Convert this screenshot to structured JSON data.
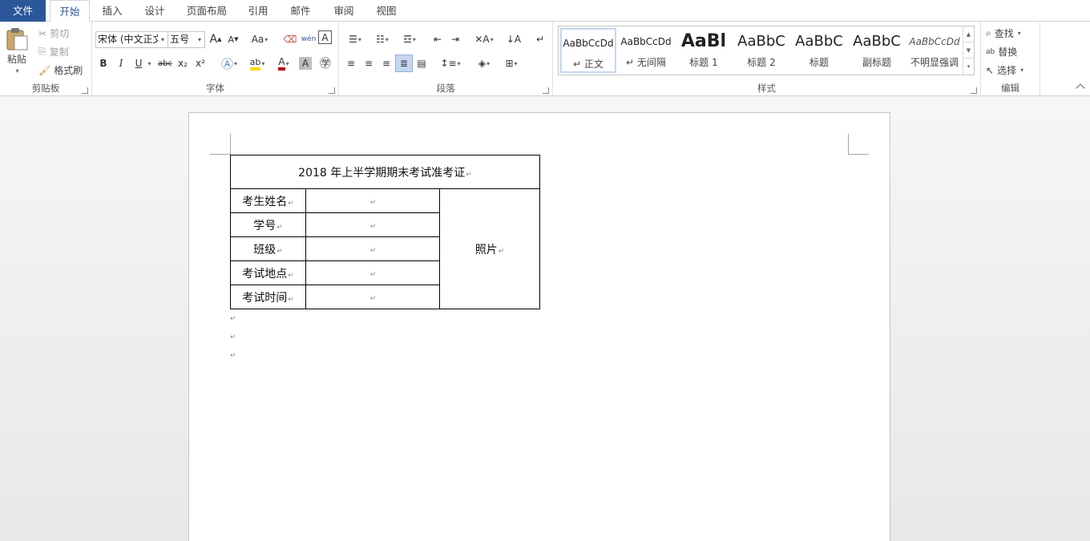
{
  "tabs": [
    "文件",
    "开始",
    "插入",
    "设计",
    "页面布局",
    "引用",
    "邮件",
    "审阅",
    "视图"
  ],
  "clipboard": {
    "label": "剪贴板",
    "paste": "粘贴",
    "cut": "剪切",
    "copy": "复制",
    "format_painter": "格式刷"
  },
  "font": {
    "label": "字体",
    "name": "宋体 (中文正文)",
    "size": "五号",
    "grow": "A",
    "shrink": "A",
    "case": "Aa",
    "phonetic": "wén",
    "bold": "B",
    "italic": "I",
    "underline": "U",
    "strike": "abc",
    "sub": "x₂",
    "sup": "x²",
    "highlight_color": "#ffd700",
    "font_color": "#c00000"
  },
  "paragraph": {
    "label": "段落"
  },
  "styles": {
    "label": "样式",
    "items": [
      {
        "sample": "AaBbCcDd",
        "name": "正文"
      },
      {
        "sample": "AaBbCcDd",
        "name": "无间隔"
      },
      {
        "sample": "AaBl",
        "name": "标题 1"
      },
      {
        "sample": "AaBbC",
        "name": "标题 2"
      },
      {
        "sample": "AaBbC",
        "name": "标题"
      },
      {
        "sample": "AaBbC",
        "name": "副标题"
      },
      {
        "sample": "AaBbCcDd",
        "name": "不明显强调"
      }
    ]
  },
  "editing": {
    "label": "编辑",
    "find": "查找",
    "replace": "替换",
    "select": "选择"
  },
  "document": {
    "title": "2018 年上半学期期末考试准考证",
    "rows": [
      {
        "label": "考生姓名"
      },
      {
        "label": "学号"
      },
      {
        "label": "班级"
      },
      {
        "label": "考试地点"
      },
      {
        "label": "考试时间"
      }
    ],
    "photo": "照片",
    "mark": "↵"
  },
  "colors": {
    "accent": "#2b579a"
  }
}
